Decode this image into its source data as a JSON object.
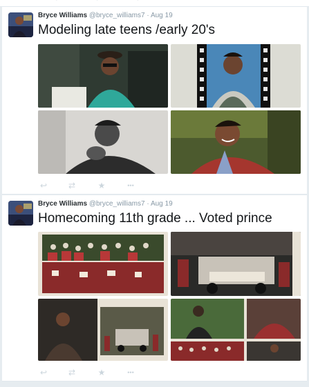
{
  "tweets": [
    {
      "author": "Bryce Williams",
      "handle": "@bryce_williams7",
      "separator": "·",
      "time": "Aug 19",
      "text": "Modeling late teens /early 20's",
      "photo_count": 4
    },
    {
      "author": "Bryce Williams",
      "handle": "@bryce_williams7",
      "separator": "·",
      "time": "Aug 19",
      "text": "Homecoming 11th grade ... Voted prince",
      "photo_count": 4
    }
  ],
  "actions": [
    "reply-icon",
    "retweet-icon",
    "favorite-icon",
    "more-icon"
  ],
  "colors": {
    "background": "#e6ecf0",
    "card": "#ffffff",
    "meta": "#8899a6",
    "action": "#ccd6dd"
  }
}
